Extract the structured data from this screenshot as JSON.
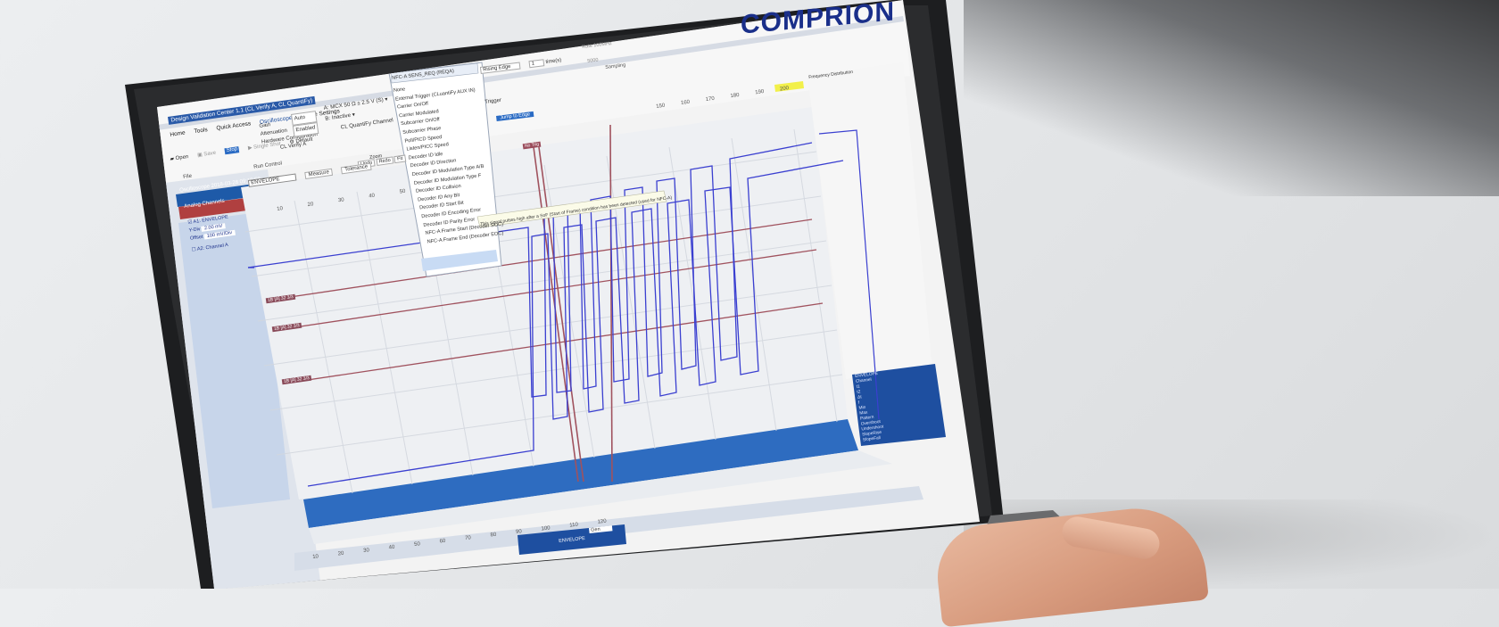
{
  "app": {
    "window_title": "Design Validation Center 1.1 (CL Verify A, CL QuantiFy)",
    "brand": "COMPRION",
    "ribbon_tabs": [
      "Home",
      "Tools",
      "Quick Access",
      "Oscilloscope",
      "Scope Settings"
    ],
    "file_group": {
      "open": "Open",
      "save": "Save",
      "label": "File"
    },
    "run_group": {
      "stop": "Stop",
      "single_shot": "Single Shot",
      "default": "Default",
      "label": "Run Control"
    },
    "config": {
      "gain": "Gain",
      "attenuation": "Attenuation",
      "hardware": "Hardware Configuration",
      "auto": "Auto",
      "enabled": "Enabled",
      "channel_label": "CL Verify A"
    },
    "channel_a": {
      "prefix": "A:",
      "value": "MCX 50 Ω ± 2.5 V (S)"
    },
    "channel_b": {
      "prefix": "B:",
      "value": "Inactive"
    },
    "quantify_channel": "CL QuantiFy Channel",
    "dropdown": {
      "selected": "NFC-A SENS_REQ (REQA)",
      "items": [
        "None",
        "External Trigger (CLuantiFy AUX IN)",
        "Carrier On/Off",
        "Carrier Modulated",
        "Subcarrier On/Off",
        "Subcarrier Phase",
        "Poll/PICD Speed",
        "Listen/PICC Speed",
        "Decoder ID Idle",
        "Decoder ID Direction",
        "Decoder ID Modulation Type A/B",
        "Decoder ID Modulation Type F",
        "Decoder ID Collision",
        "Decoder ID Any Bit",
        "Decoder ID Start Bit",
        "Decoder ID Encoding Error",
        "Decoder ID Parity Error",
        "NFC-A Frame Start (Decoder SOC)",
        "NFC-A Frame End (Decoder EOC)"
      ],
      "tooltip": "This signal pulses high after a SoF (Start of Frame) condition has been detected (used for NFC-A)"
    },
    "trigger": {
      "edge": "Rising Edge",
      "count": "1",
      "unit": "time(s)",
      "label": "Trigger",
      "jump": "Jump to Edge"
    },
    "sampling": {
      "rate_label": "Rate 100MHz",
      "val1": "5000",
      "label": "Sampling"
    },
    "zoom": {
      "label": "Zoom",
      "undo": "Undo",
      "redo": "Redo",
      "fit": "Fit"
    },
    "oscilloscope_panel": {
      "title": "Oscilloscope 2018-03-28 09:18:58",
      "channel_dropdown": "ENVELOPE",
      "measure": "Measure",
      "tolerance": "Tolerance",
      "analog_channels": "Analog Channels",
      "envelope": "A1: ENVELOPE",
      "y_div": "Y-Div",
      "y_div_val": "2.00 mV",
      "offset": "Offset",
      "offset_val": "100 mV/Div",
      "channel_a2": "A2: Channel A"
    },
    "markers": [
      "No Trig",
      "1B [A] 32 3/3",
      "1B [A] 32 3/3",
      "1B [A] 32 3/3"
    ],
    "ruler_ticks_top": [
      "10",
      "20",
      "30",
      "40",
      "50"
    ],
    "ruler_ticks_right": [
      "150",
      "160",
      "170",
      "180",
      "190",
      "200"
    ],
    "ruler_ticks_bottom": [
      "10",
      "20",
      "30",
      "40",
      "50",
      "60",
      "70",
      "80",
      "90",
      "100",
      "110",
      "120"
    ],
    "freq_label": "Frequency Distribution",
    "stats": {
      "title": "ENVELOPE",
      "rows": [
        "Channel",
        "t1",
        "t2",
        "Δt",
        "f",
        "Min",
        "Max",
        "Pattern",
        "Overshoot",
        "Undershoot",
        "SlopeRise",
        "SlopeFall",
        "Overshoot"
      ]
    },
    "bottom_tab": "ENVELOPE",
    "bottom_tab2": "Gen"
  },
  "chart_data": {
    "type": "line",
    "series": [
      {
        "name": "ENVELOPE",
        "color": "#3a3fd0"
      },
      {
        "name": "A2",
        "color": "#9a4b5a"
      }
    ]
  }
}
